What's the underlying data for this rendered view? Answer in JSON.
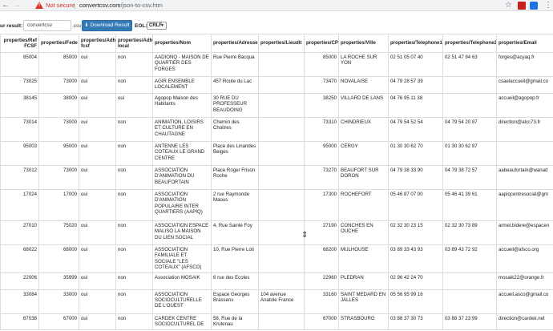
{
  "browser": {
    "not_secure_label": "Not secure",
    "separator": "|",
    "url_domain": "convertcsv.com",
    "url_path": "/json-to-csv.htm"
  },
  "controls": {
    "result_label": "ur result:",
    "filename_value": "convertcsv",
    "extension": ".csv",
    "download_label": "Download Result",
    "eol_label": "EOL:",
    "eol_value": "CRLF"
  },
  "table": {
    "headers": [
      "properties/Ref FCSF",
      "properties/Fede",
      "properties/Adh fcsf",
      "properties/Adh local",
      "properties/Nom",
      "properties/Adresse",
      "properties/Lieudit",
      "properties/CP",
      "properties/Ville",
      "properties/Telephone1",
      "properties/Telephone2",
      "properties/Email"
    ],
    "rows": [
      [
        "85004",
        "85000",
        "oui",
        "non",
        "AADIONQ - MAISON DE QUARTIER DES FORGES",
        "Rue Pierre Bacqua",
        "",
        "85000",
        "LA ROCHE SUR YON",
        "02 51 05 07 40",
        "02 51 47 94 63",
        "forges@acyaq.fr"
      ],
      [
        "73025",
        "73000",
        "oui",
        "non",
        "AGIR ENSEMBLE LOCALEMENT",
        "457 Route du Lac",
        "",
        "73470",
        "NOVALAISE",
        "04 79 28 57 39",
        "",
        "csaelaccueil@gmail.co"
      ],
      [
        "38145",
        "38000",
        "oui",
        "oui",
        "Agopop Maison des Habitants",
        "30 RUE DU PROFESSEUR BEAUDOING",
        "",
        "38250",
        "VILLARD DE LANS",
        "04 76 95 11 38",
        "",
        "accueil@agopop.fr"
      ],
      [
        "73014",
        "73000",
        "oui",
        "non",
        "ANIMATION, LOISIRS ET CULTURE EN CHAUTAGNE",
        "Chemin des Choitres",
        "",
        "73310",
        "CHINDRIEUX",
        "04 79 54 52 54",
        "04 79 54 20 87",
        "direction@alcc73.fr"
      ],
      [
        "95003",
        "95000",
        "oui",
        "non",
        "ANTENNE LES COTEAUX LE GRAND CENTRE",
        "Place des Linandes Beiges",
        "",
        "95000",
        "CERGY",
        "01 30 30 62 70",
        "01 30 30 62 87",
        ""
      ],
      [
        "73012",
        "73000",
        "oui",
        "non",
        "ASSOCIATION D'ANIMATION DU BEAUFORTAIN",
        "Place Roger Frison Roche",
        "",
        "73270",
        "BEAUFORT SUR DORON",
        "04 79 38 33 90",
        "04 79 38 72 57",
        "aabeaufortain@wanad"
      ],
      [
        "17024",
        "17000",
        "oui",
        "non",
        "ASSOCIATION D'ANIMATION POPULAIRE INTER QUARTIERS (AAPIQ)",
        "2 rue Raymonde Maous",
        "",
        "17300",
        "ROCHEFORT",
        "05 46 87 07 00",
        "05 46 41 39 61",
        "aapiqcentresocial@gm"
      ],
      [
        "27010",
        "75020",
        "oui",
        "non",
        "ASSOCIATION ESPACE MALISO LA MAISON DU LIEN SOCIAL",
        "4, Rue Sainte Foy",
        "",
        "27190",
        "CONCHES EN OUCHE",
        "02 32 30 23 15",
        "02 32 30 73 89",
        "armel.bidere@espacen"
      ],
      [
        "68022",
        "68000",
        "oui",
        "non",
        "ASSOCIATION FAMILIALE ET SOCIALE \"LES COTEAUX\" (AFSCO)",
        "10, Rue Pierre Loti",
        "",
        "68200",
        "MULHOUSE",
        "03 89 33 43 93",
        "03 89 43 72 92",
        "accueil@afsco.org"
      ],
      [
        "22006",
        "35999",
        "oui",
        "non",
        "Association MOSAIK",
        "6 rue des Ecoles",
        "",
        "22960",
        "PLEDRAN",
        "02 96 42 24 70",
        "",
        "mosaik22@orange.fr"
      ],
      [
        "33084",
        "33000",
        "oui",
        "non",
        "ASSOCIATION SOCIOCULTURELLE DE L'OUEST",
        "Espace Georges Brassens",
        "104 avenue Anatole France",
        "33160",
        "SAINT MEDARD EN JALLES",
        "05 56 95 99 16",
        "",
        "accueil.asco@gmail.co"
      ],
      [
        "67038",
        "67000",
        "oui",
        "non",
        "CARDEK CENTRE SOCIOCULTUREL DE",
        "58, Rue de la Krutenau",
        "",
        "67000",
        "STRASBOURG",
        "03 88 37 30 73",
        "03 88 37 23 99",
        "direction@cardek.net"
      ]
    ]
  }
}
